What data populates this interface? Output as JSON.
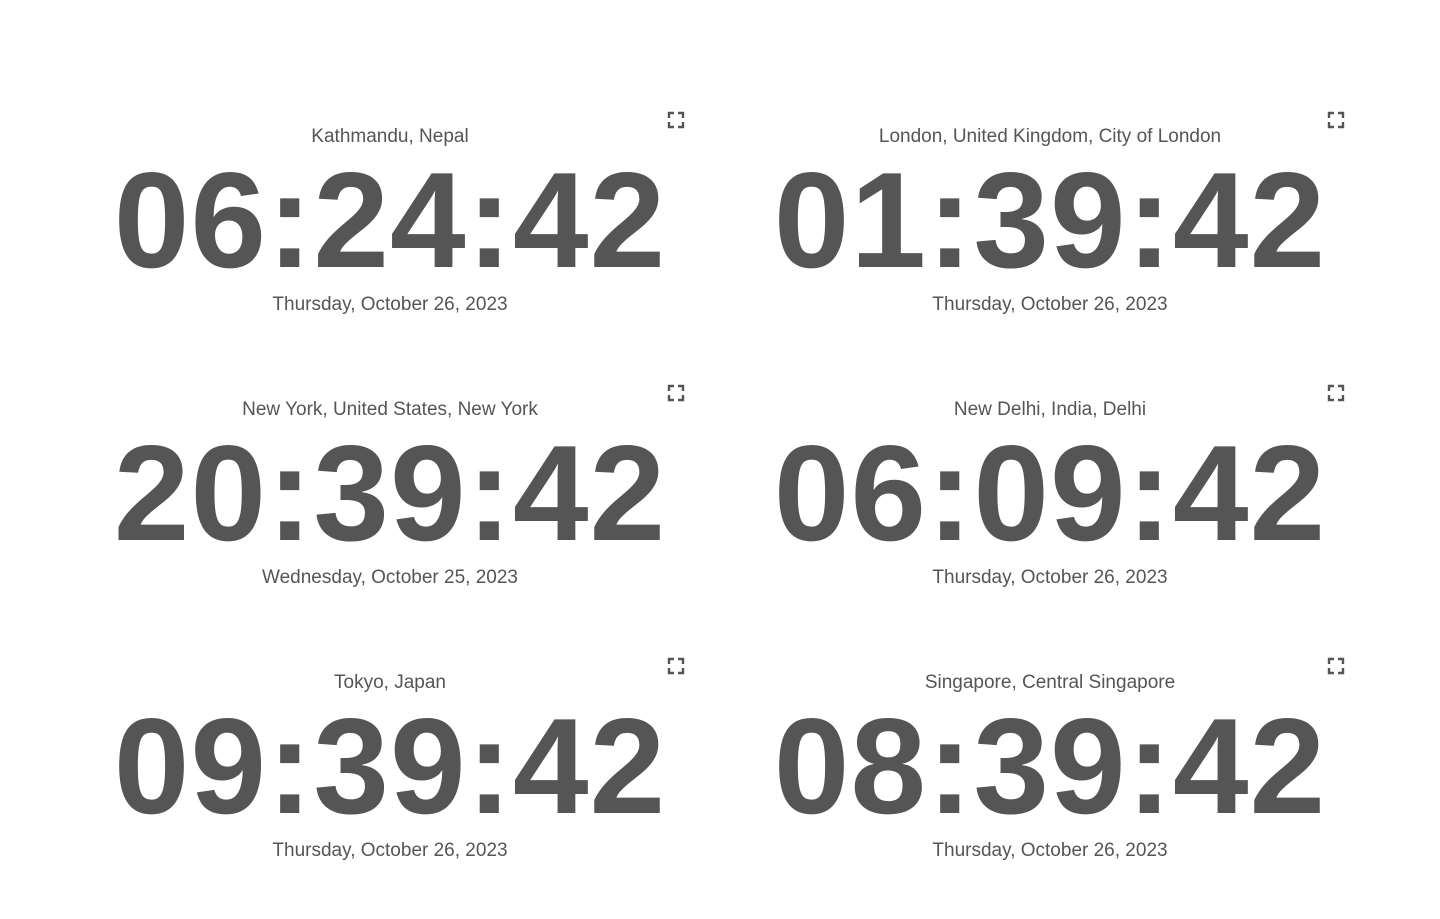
{
  "clocks": [
    {
      "location": "Kathmandu, Nepal",
      "time": "06:24:42",
      "date": "Thursday, October 26, 2023",
      "icon": "fullscreen-icon"
    },
    {
      "location": "London, United Kingdom, City of London",
      "time": "01:39:42",
      "date": "Thursday, October 26, 2023",
      "icon": "fullscreen-icon"
    },
    {
      "location": "New York, United States, New York",
      "time": "20:39:42",
      "date": "Wednesday, October 25, 2023",
      "icon": "fullscreen-icon"
    },
    {
      "location": "New Delhi, India, Delhi",
      "time": "06:09:42",
      "date": "Thursday, October 26, 2023",
      "icon": "fullscreen-icon"
    },
    {
      "location": "Tokyo, Japan",
      "time": "09:39:42",
      "date": "Thursday, October 26, 2023",
      "icon": "fullscreen-icon"
    },
    {
      "location": "Singapore, Central Singapore",
      "time": "08:39:42",
      "date": "Thursday, October 26, 2023",
      "icon": "fullscreen-icon"
    }
  ],
  "colors": {
    "text": "#555555",
    "background": "#ffffff"
  }
}
